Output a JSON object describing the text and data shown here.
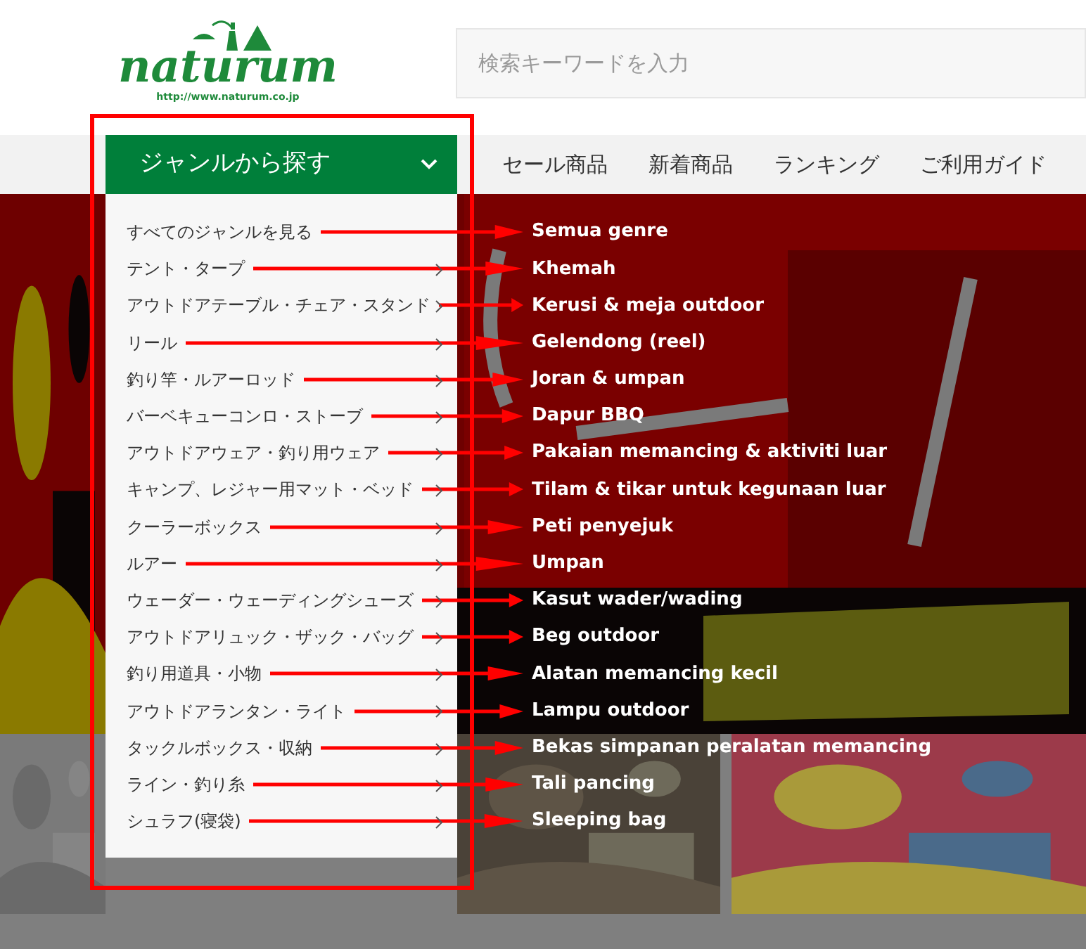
{
  "header": {
    "logo": {
      "name": "naturum",
      "url": "http://www.naturum.co.jp"
    },
    "search": {
      "placeholder": "検索キーワードを入力"
    }
  },
  "nav": {
    "genre_button": {
      "label": "ジャンルから探す",
      "expanded": true
    },
    "links": [
      "セール商品",
      "新着商品",
      "ランキング",
      "ご利用ガイド"
    ]
  },
  "genre_menu": {
    "items": [
      {
        "label": "すべてのジャンルを見る",
        "has_submenu": false,
        "annotation": "Semua genre"
      },
      {
        "label": "テント・タープ",
        "has_submenu": true,
        "annotation": "Khemah"
      },
      {
        "label": "アウトドアテーブル・チェア・スタンド",
        "has_submenu": true,
        "annotation": "Kerusi & meja outdoor"
      },
      {
        "label": "リール",
        "has_submenu": true,
        "annotation": "Gelendong (reel)"
      },
      {
        "label": "釣り竿・ルアーロッド",
        "has_submenu": true,
        "annotation": "Joran & umpan"
      },
      {
        "label": "バーベキューコンロ・ストーブ",
        "has_submenu": true,
        "annotation": "Dapur BBQ"
      },
      {
        "label": "アウトドアウェア・釣り用ウェア",
        "has_submenu": true,
        "annotation": "Pakaian memancing & aktiviti luar"
      },
      {
        "label": "キャンプ、レジャー用マット・ベッド",
        "has_submenu": true,
        "annotation": "Tilam & tikar untuk kegunaan luar"
      },
      {
        "label": "クーラーボックス",
        "has_submenu": true,
        "annotation": "Peti penyejuk"
      },
      {
        "label": "ルアー",
        "has_submenu": true,
        "annotation": "Umpan"
      },
      {
        "label": "ウェーダー・ウェーディングシューズ",
        "has_submenu": true,
        "annotation": "Kasut wader/wading"
      },
      {
        "label": "アウトドアリュック・ザック・バッグ",
        "has_submenu": true,
        "annotation": "Beg outdoor"
      },
      {
        "label": "釣り用道具・小物",
        "has_submenu": true,
        "annotation": "Alatan memancing kecil"
      },
      {
        "label": "アウトドアランタン・ライト",
        "has_submenu": true,
        "annotation": "Lampu outdoor"
      },
      {
        "label": "タックルボックス・収納",
        "has_submenu": true,
        "annotation": "Bekas simpanan peralatan memancing"
      },
      {
        "label": "ライン・釣り糸",
        "has_submenu": true,
        "annotation": "Tali pancing"
      },
      {
        "label": "シュラフ(寝袋)",
        "has_submenu": true,
        "annotation": "Sleeping bag"
      }
    ]
  }
}
